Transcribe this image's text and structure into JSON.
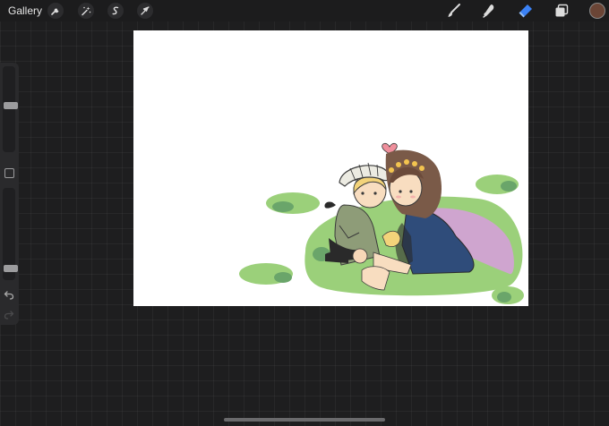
{
  "topbar": {
    "gallery_label": "Gallery",
    "left_tools": [
      {
        "name": "actions",
        "icon": "wrench-icon"
      },
      {
        "name": "adjustments",
        "icon": "magic-wand-icon"
      },
      {
        "name": "selection",
        "icon": "selection-s-icon"
      },
      {
        "name": "transform",
        "icon": "cursor-arrow-icon"
      }
    ],
    "right_tools": [
      {
        "name": "brush",
        "icon": "brush-icon",
        "active": false
      },
      {
        "name": "smudge",
        "icon": "smudge-icon",
        "active": false
      },
      {
        "name": "eraser",
        "icon": "eraser-icon",
        "active": true
      },
      {
        "name": "layers",
        "icon": "layers-icon",
        "active": false
      }
    ],
    "current_color": "#6b4536",
    "accent_color": "#3b82f6"
  },
  "sidebar": {
    "brush_size_level": 0.55,
    "opacity_level": 0.09,
    "modify_icon": "square-modify-icon",
    "undo_icon": "undo-arrow-icon",
    "redo_icon": "redo-arrow-icon"
  },
  "canvas": {
    "background": "#ffffff",
    "artwork": "illustration-two-characters-on-grass"
  }
}
